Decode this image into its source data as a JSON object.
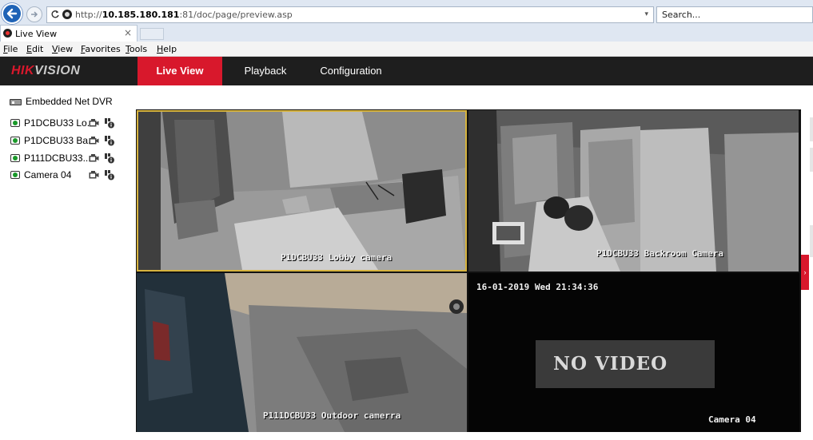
{
  "browser": {
    "url_prefix": "http://",
    "url_host": "10.185.180.181",
    "url_rest": ":81/doc/page/preview.asp",
    "search_placeholder": "Search...",
    "tab_title": "Live View",
    "tab_close": "×",
    "menu": [
      "File",
      "Edit",
      "View",
      "Favorites",
      "Tools",
      "Help"
    ]
  },
  "app": {
    "logo_red": "HIK",
    "logo_rest": "VISION",
    "nav": [
      {
        "label": "Live View",
        "active": true
      },
      {
        "label": "Playback",
        "active": false
      },
      {
        "label": "Configuration",
        "active": false
      }
    ]
  },
  "sidebar": {
    "device": "Embedded Net DVR",
    "cameras": [
      {
        "label": "P1DCBU33 Lo..."
      },
      {
        "label": "P1DCBU33 Ba..."
      },
      {
        "label": "P111DCBU33..."
      },
      {
        "label": "Camera 04"
      }
    ]
  },
  "views": {
    "cam1_osd": "P1DCBU33  Lobby camera",
    "cam2_osd": "P1DCBU33 Backroom Camera",
    "cam3_osd": "P111DCBU33 Outdoor camerra",
    "cam4_timestamp": "16-01-2019 Wed 21:34:36",
    "cam4_status": "NO VIDEO",
    "cam4_name": "Camera 04"
  },
  "colors": {
    "brand_red": "#d8182c",
    "header_bg": "#1e1e1e",
    "selected_border": "#d6b33e"
  }
}
